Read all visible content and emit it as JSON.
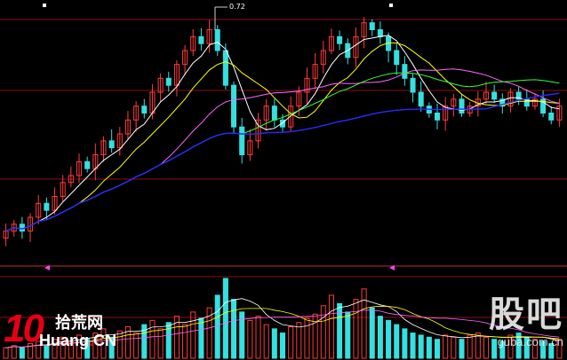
{
  "watermark_left": {
    "digits": "10",
    "site_cn": "拾荒网",
    "domain_main": "Huang",
    "domain_dot": ".",
    "domain_tld": "CN"
  },
  "watermark_right": {
    "brand_cn": "股吧",
    "url": "guba.com.cn"
  },
  "peak_label": "0.72",
  "colors": {
    "background": "#000000",
    "up": "#ff3b3b",
    "down": "#34e0e0",
    "ma5": "#ffffff",
    "ma10": "#ffff00",
    "ma20": "#ff66ff",
    "ma30": "#33ff33",
    "ma60": "#2a2aff",
    "grid": "#8a1010"
  },
  "chart_data": {
    "type": "candlestick",
    "price_close": [
      0.42,
      0.43,
      0.42,
      0.44,
      0.46,
      0.45,
      0.47,
      0.49,
      0.5,
      0.52,
      0.51,
      0.53,
      0.55,
      0.54,
      0.56,
      0.58,
      0.6,
      0.59,
      0.62,
      0.64,
      0.63,
      0.66,
      0.68,
      0.7,
      0.69,
      0.71,
      0.68,
      0.63,
      0.57,
      0.53,
      0.55,
      0.58,
      0.6,
      0.58,
      0.57,
      0.6,
      0.62,
      0.64,
      0.66,
      0.68,
      0.7,
      0.69,
      0.67,
      0.7,
      0.72,
      0.71,
      0.7,
      0.68,
      0.66,
      0.64,
      0.62,
      0.6,
      0.59,
      0.58,
      0.6,
      0.61,
      0.59,
      0.6,
      0.61,
      0.62,
      0.61,
      0.6,
      0.62,
      0.61,
      0.6,
      0.61,
      0.59,
      0.58,
      0.6
    ],
    "volume": [
      5,
      6,
      5,
      7,
      8,
      6,
      9,
      10,
      8,
      11,
      9,
      12,
      14,
      10,
      13,
      15,
      12,
      16,
      18,
      14,
      17,
      20,
      16,
      22,
      19,
      24,
      30,
      38,
      28,
      22,
      18,
      20,
      16,
      14,
      12,
      15,
      17,
      19,
      21,
      25,
      30,
      26,
      22,
      28,
      33,
      24,
      20,
      18,
      16,
      14,
      12,
      11,
      10,
      9,
      11,
      10,
      9,
      11,
      12,
      10,
      9,
      8,
      11,
      12,
      10,
      9,
      8,
      7,
      9
    ],
    "ma_periods": [
      5,
      10,
      20,
      30,
      60
    ],
    "panels": [
      "price",
      "volume"
    ]
  }
}
